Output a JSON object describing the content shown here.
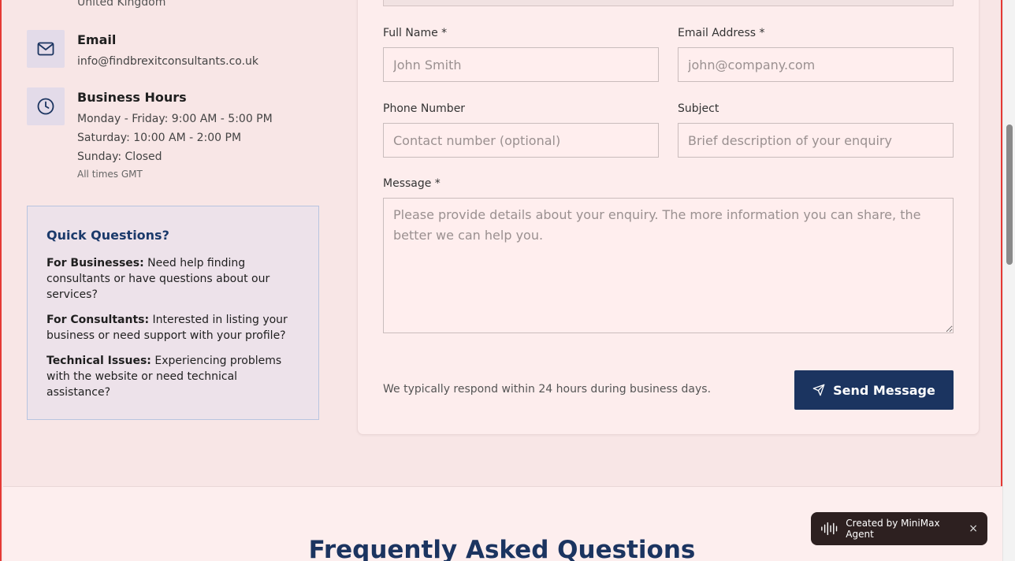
{
  "contact_info": {
    "country": "United Kingdom",
    "email": {
      "title": "Email",
      "value": "info@findbrexitconsultants.co.uk",
      "icon": "mail-icon"
    },
    "hours": {
      "title": "Business Hours",
      "lines": [
        "Monday - Friday: 9:00 AM - 5:00 PM",
        "Saturday: 10:00 AM - 2:00 PM",
        "Sunday: Closed"
      ],
      "note": "All times GMT",
      "icon": "clock-icon"
    }
  },
  "quick_questions": {
    "title": "Quick Questions?",
    "items": [
      {
        "label": "For Businesses:",
        "text": " Need help finding consultants or have questions about our services?"
      },
      {
        "label": "For Consultants:",
        "text": " Interested in listing your business or need support with your profile?"
      },
      {
        "label": "Technical Issues:",
        "text": " Experiencing problems with the website or need technical assistance?"
      }
    ]
  },
  "form": {
    "full_name": {
      "label": "Full Name *",
      "placeholder": "John Smith",
      "value": ""
    },
    "email": {
      "label": "Email Address *",
      "placeholder": "john@company.com",
      "value": ""
    },
    "phone": {
      "label": "Phone Number",
      "placeholder": "Contact number (optional)",
      "value": ""
    },
    "subject": {
      "label": "Subject",
      "placeholder": "Brief description of your enquiry",
      "value": ""
    },
    "message": {
      "label": "Message *",
      "placeholder": "Please provide details about your enquiry. The more information you can share, the better we can help you.",
      "value": ""
    },
    "respond_note": "We typically respond within 24 hours during business days.",
    "submit_label": "Send Message",
    "submit_icon": "send-icon"
  },
  "faq": {
    "title": "Frequently Asked Questions"
  },
  "badge": {
    "text": "Created by MiniMax Agent",
    "close": "×",
    "icon": "waveform-icon"
  },
  "colors": {
    "accent": "#1b3460",
    "background": "#f8e6e6",
    "border_accent": "#e53935"
  }
}
